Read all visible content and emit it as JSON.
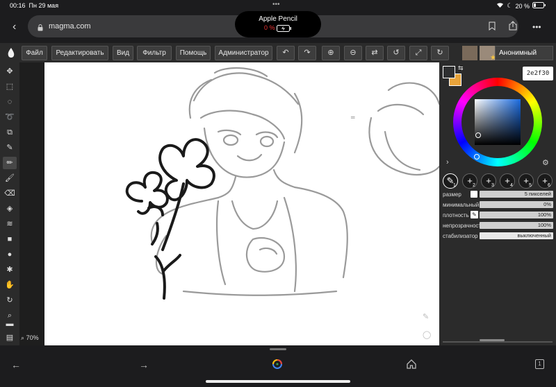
{
  "status": {
    "time": "00:16",
    "date": "Пн 29 мая",
    "battery": "20 %"
  },
  "browser": {
    "url": "magma.com",
    "pencil_title": "Apple Pencil",
    "pencil_percent": "0 %"
  },
  "menu": {
    "file": "Файл",
    "edit": "Редактировать",
    "view": "Вид",
    "filter": "Фильтр",
    "help": "Помощь",
    "admin": "Администратор"
  },
  "user": {
    "name": "Анонимный"
  },
  "color": {
    "hex": "2e2f30",
    "primary": "#2e2f30",
    "secondary": "#e8a33a"
  },
  "brushes": [
    "1",
    "2",
    "3",
    "4",
    "5",
    "6"
  ],
  "props": {
    "size_label": "размер",
    "size_value": "5 пикселей",
    "min_label": "минимальный",
    "min_value": "0%",
    "density_label": "плотность",
    "density_value": "100%",
    "opacity_label": "непрозрачность",
    "opacity_value": "100%",
    "stabilizer_label": "стабилизатор",
    "stabilizer_value": "выключенный"
  },
  "zoom": "70%"
}
